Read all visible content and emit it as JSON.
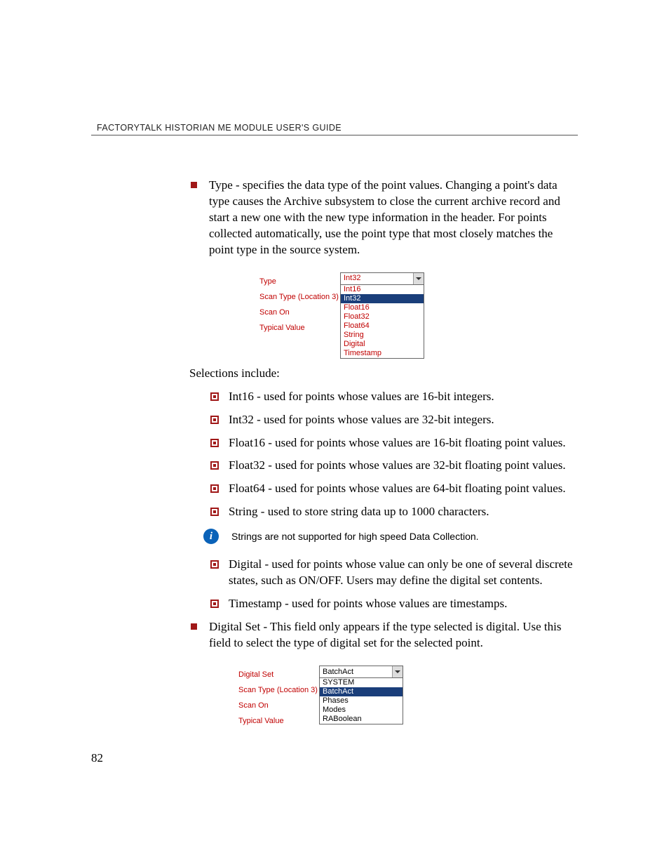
{
  "header": "FACTORYTALK HISTORIAN ME MODULE USER'S GUIDE",
  "main_bullets": [
    "Type - specifies the data type of the point values. Changing a point's data type causes the Archive subsystem to close the current archive record and start a new one with the new type information in the header. For points collected automatically, use the point type that most closely matches the point type in the source system."
  ],
  "fig1": {
    "labels": [
      "Type",
      "Scan Type (Location 3)",
      "Scan On",
      "Typical Value"
    ],
    "selected": "Int32",
    "highlighted": "Int32",
    "options": [
      "Int16",
      "Int32",
      "Float16",
      "Float32",
      "Float64",
      "String",
      "Digital",
      "Timestamp"
    ]
  },
  "selections_intro": "Selections include:",
  "selections": [
    "Int16 - used for points whose values are 16-bit integers.",
    "Int32 -  used for points whose values are 32-bit integers.",
    "Float16 -  used for points whose values are 16-bit floating point values.",
    "Float32 - used for points whose values are 32-bit floating point values.",
    "Float64  - used for points whose values are 64-bit floating point values.",
    "String -  used to store string data up to 1000 characters."
  ],
  "note": "Strings are not supported for high speed Data Collection.",
  "selections2": [
    "Digital - used for points whose value can only be one of several discrete states, such as ON/OFF. Users may define the digital set contents.",
    "Timestamp - used for points whose values are timestamps."
  ],
  "main_bullets2": [
    "Digital Set - This field only appears if the type selected is digital. Use this field to select the type of digital set for the selected point."
  ],
  "fig2": {
    "labels": [
      "Digital Set",
      "Scan Type (Location 3)",
      "Scan On",
      "Typical Value"
    ],
    "selected": "BatchAct",
    "highlighted": "BatchAct",
    "options": [
      "SYSTEM",
      "BatchAct",
      "Phases",
      "Modes",
      "RABoolean"
    ]
  },
  "page_number": "82"
}
